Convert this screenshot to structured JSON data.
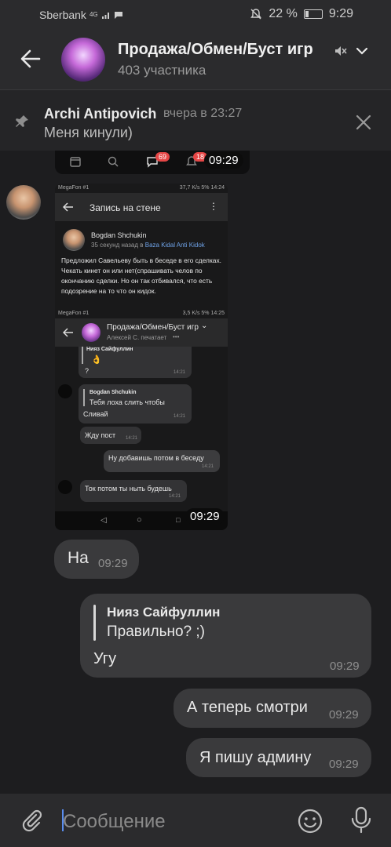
{
  "status": {
    "carrier": "Sberbank",
    "signal": "4G",
    "battery": "22 %",
    "battery_level": 0.22,
    "time": "9:29"
  },
  "header": {
    "title": "Продажа/Обмен/Буст игр",
    "subtitle": "403 участника"
  },
  "pinned": {
    "name": "Archi Antipovich",
    "time": "вчера в 23:27",
    "text": "Меня кинули)"
  },
  "attachment_top": {
    "badge_messages": "69",
    "badge_notifications": "18",
    "time": "09:29"
  },
  "shot": {
    "sb1_left": "MegaFon #1",
    "sb1_right": "37,7 K/s  5%  14:24",
    "wall_title": "Запись на стене",
    "author": "Bogdan Shchukin",
    "meta_prefix": "35 секунд назад в ",
    "meta_link": "Baza Kidal Anti Kidok",
    "post_text": "Предложил Савельеву быть в беседе в его сделках. Чекать кинет он или нет(спрашивать челов по окончанию сделки. Но он так отбивался, что есть подозрение на то что он кидок.",
    "sb2_left": "MegaFon #1",
    "sb2_right": "3,5 K/s  5%  14:25",
    "chat_title": "Продажа/Обмен/Буст игр",
    "chat_typing": "Алексей С. печатает",
    "m1_reply_name": "Нияз Сайфуллин",
    "m1_emoji": "👌",
    "m1_text": "?",
    "m1_time": "14:21",
    "m2_reply_name": "Bogdan Shchukin",
    "m2_reply_text": "Тебя лоха слить чтобы",
    "m2_text": "Сливай",
    "m2_time": "14:21",
    "m3_text": "Жду пост",
    "m3_time": "14:21",
    "m4_text": "Ну добавишь потом в беседу",
    "m4_time": "14:21",
    "m5_text": "Ток потом ты ныть будешь",
    "m5_time": "14:21",
    "time": "09:29"
  },
  "messages": [
    {
      "text": "На",
      "time": "09:29"
    },
    {
      "reply_name": "Нияз Сайфуллин",
      "reply_text": "Правильно? ;)",
      "text": "Угу",
      "time": "09:29"
    },
    {
      "text": "А теперь смотри",
      "time": "09:29"
    },
    {
      "text": "Я пишу админу",
      "time": "09:29"
    }
  ],
  "composer": {
    "placeholder": "Сообщение"
  }
}
